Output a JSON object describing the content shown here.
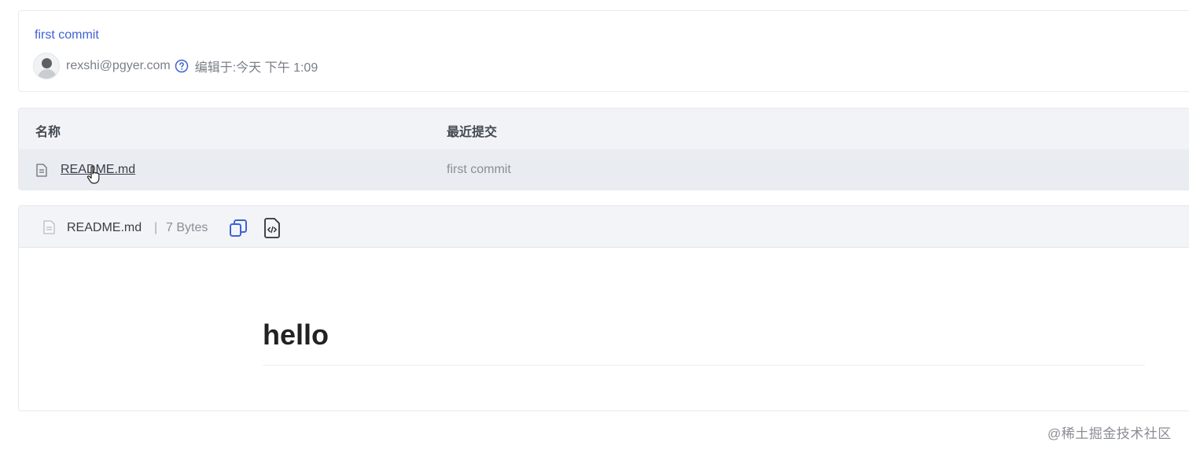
{
  "commit": {
    "title": "first commit",
    "author": "rexshi@pgyer.com",
    "edited": "编辑于:今天 下午 1:09"
  },
  "file_list": {
    "columns": [
      "名称",
      "最近提交"
    ],
    "rows": [
      {
        "name": "README.md",
        "last_commit": "first commit",
        "icon": "file-icon"
      }
    ]
  },
  "readme": {
    "file_name": "README.md",
    "separator": "|",
    "size": "7 Bytes",
    "heading": "hello"
  },
  "watermark": "@稀土掘金技术社区",
  "colors": {
    "link": "#3d63d6",
    "header_bg": "#f2f4f7",
    "row_bg": "#e9ecf1",
    "text_muted": "#8a8f97"
  }
}
